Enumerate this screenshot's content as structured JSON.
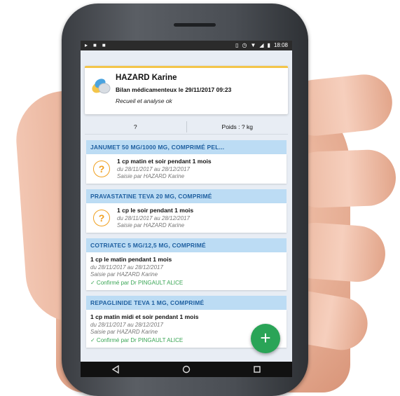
{
  "status_bar": {
    "time": "18:08"
  },
  "summary": {
    "patient_name": "HAZARD Karine",
    "bilan": "Bilan médicamenteux le 29/11/2017 09:23",
    "recueil": "Recueil et analyse ok"
  },
  "stats": {
    "left": "?",
    "right": "Poids : ? kg"
  },
  "medications": [
    {
      "name": "JANUMET 50 MG/1000 MG, COMPRIMÉ PEL...",
      "posology": "1 cp matin et soir pendant 1 mois",
      "dates": "du 28/11/2017 au 28/12/2017",
      "saisie": "Saisie par HAZARD Karine",
      "status_icon": "question-icon"
    },
    {
      "name": "PRAVASTATINE TEVA 20 MG, COMPRIMÉ",
      "posology": "1 cp le soir pendant 1 mois",
      "dates": "du 28/11/2017 au 28/12/2017",
      "saisie": "Saisie par HAZARD Karine",
      "status_icon": "question-icon"
    },
    {
      "name": "COTRIATEC 5 MG/12,5 MG, COMPRIMÉ",
      "posology": "1 cp le matin pendant 1 mois",
      "dates": "du 28/11/2017 au 28/12/2017",
      "saisie": "Saisie par HAZARD Karine",
      "confirmation": "✓ Confirmé par Dr PINGAULT ALICE"
    },
    {
      "name": "REPAGLINIDE TEVA 1 MG, COMPRIMÉ",
      "posology": "1 cp matin midi et soir pendant 1 mois",
      "dates": "du 28/11/2017 au 28/12/2017",
      "saisie": "Saisie par HAZARD Karine",
      "confirmation": "✓ Confirmé par Dr PINGAULT ALICE"
    }
  ],
  "fab": {
    "label": "+"
  },
  "colors": {
    "accent_yellow": "#f3c54a",
    "header_blue": "#bcdcf4",
    "header_text": "#1e5fa0",
    "fab_green": "#2aa457",
    "warning_orange": "#f0a020",
    "confirm_green": "#3aa655"
  }
}
